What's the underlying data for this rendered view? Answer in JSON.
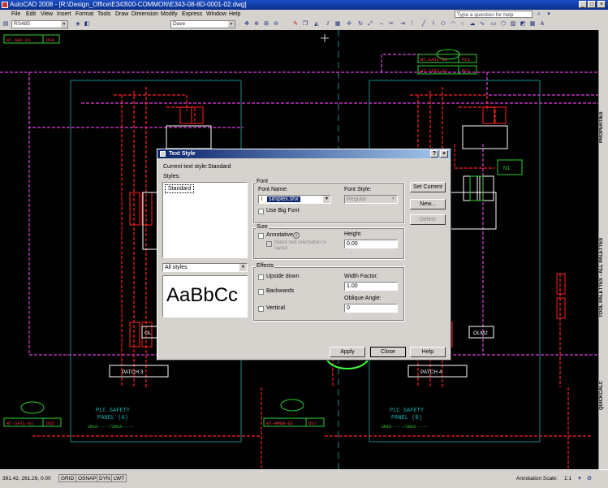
{
  "app": {
    "title": "AutoCAD 2008 - [R:\\Design_Office\\E343\\00-COMMON\\E343-08-8D-0001-02.dwg]",
    "menus": [
      "File",
      "Edit",
      "View",
      "Insert",
      "Format",
      "Tools",
      "Draw",
      "Dimension",
      "Modify",
      "Express",
      "Window",
      "Help"
    ],
    "help_placeholder": "Type a question for help",
    "window_buttons": [
      "_",
      "□",
      "×"
    ]
  },
  "toolbar": {
    "layer_value": "RS485",
    "linetype_value": "Dave"
  },
  "drawing": {
    "labels": {
      "top_left_tag_a": "WT-SW2-01",
      "top_left_tag_b": "DS8",
      "top_right_tag_a": "WT-SAT1-02",
      "top_right_tag_b": "PC1",
      "top_right_tag_c": "WT-SAT2-02",
      "top_right_tag_d": "PC2",
      "mid_right_box": "N1",
      "olm_right": "OLM2",
      "olm_left": "OL",
      "patch_left": "PATCH 3",
      "patch_right": "PATCH 4",
      "bottom_tag_1a": "WT-SAT1-01",
      "bottom_tag_1b": "DS5",
      "bottom_tag_2a": "WT-HMGN-02",
      "bottom_tag_2b": "DS7",
      "panel_left_1": "PLC SAFETY",
      "panel_left_2": "PANEL (A)",
      "panel_left_3": "SM16-----/SM18-----",
      "panel_right_1": "PLC SAFETY",
      "panel_right_2": "PANEL (B)",
      "panel_right_3": "SM16-----/SM18-----"
    }
  },
  "side_palettes": [
    "PROPERTIES",
    "TOOL PALETTES - ALL PALETTES",
    "QUICKCALC"
  ],
  "statusbar": {
    "coords": "391.42, 261.26, 0.00",
    "toggles": [
      "GRID",
      "OSNAP",
      "DYN",
      "LWT"
    ],
    "annotation_scale_label": "Annotation Scale:",
    "annotation_scale_value": "1:1"
  },
  "dialog": {
    "title": "Text Style",
    "current_style_label": "Current text style:",
    "current_style_value": "Standard",
    "styles_label": "Styles:",
    "styles_list": [
      "Standard"
    ],
    "filter_value": "All styles",
    "preview_text": "AaBbCc",
    "font_group": "Font",
    "font_name_label": "Font Name:",
    "font_name_value": "simplex.shx",
    "font_style_label": "Font Style:",
    "font_style_value": "Regular",
    "use_big_font_label": "Use Big Font",
    "size_group": "Size",
    "annotative_label": "Annotative",
    "match_orientation_label": "Match text orientation to layout",
    "height_label": "Height",
    "height_value": "0.00",
    "effects_group": "Effects",
    "upside_down_label": "Upside down",
    "backwards_label": "Backwards",
    "vertical_label": "Vertical",
    "width_factor_label": "Width Factor:",
    "width_factor_value": "1.00",
    "oblique_angle_label": "Oblique Angle:",
    "oblique_angle_value": "0",
    "buttons": {
      "set_current": "Set Current",
      "new": "New...",
      "delete": "Delete",
      "apply": "Apply",
      "close": "Close",
      "help": "Help"
    },
    "title_buttons": [
      "?",
      "×"
    ]
  },
  "colors": {
    "drawing_bg": "#000000",
    "wire_red": "#ff2020",
    "wire_magenta": "#e040e0",
    "panel_teal": "#1a8a8a",
    "tag_green": "#30d030",
    "annotation_green": "#3cff3c",
    "ui_gray": "#d6d3ce"
  }
}
